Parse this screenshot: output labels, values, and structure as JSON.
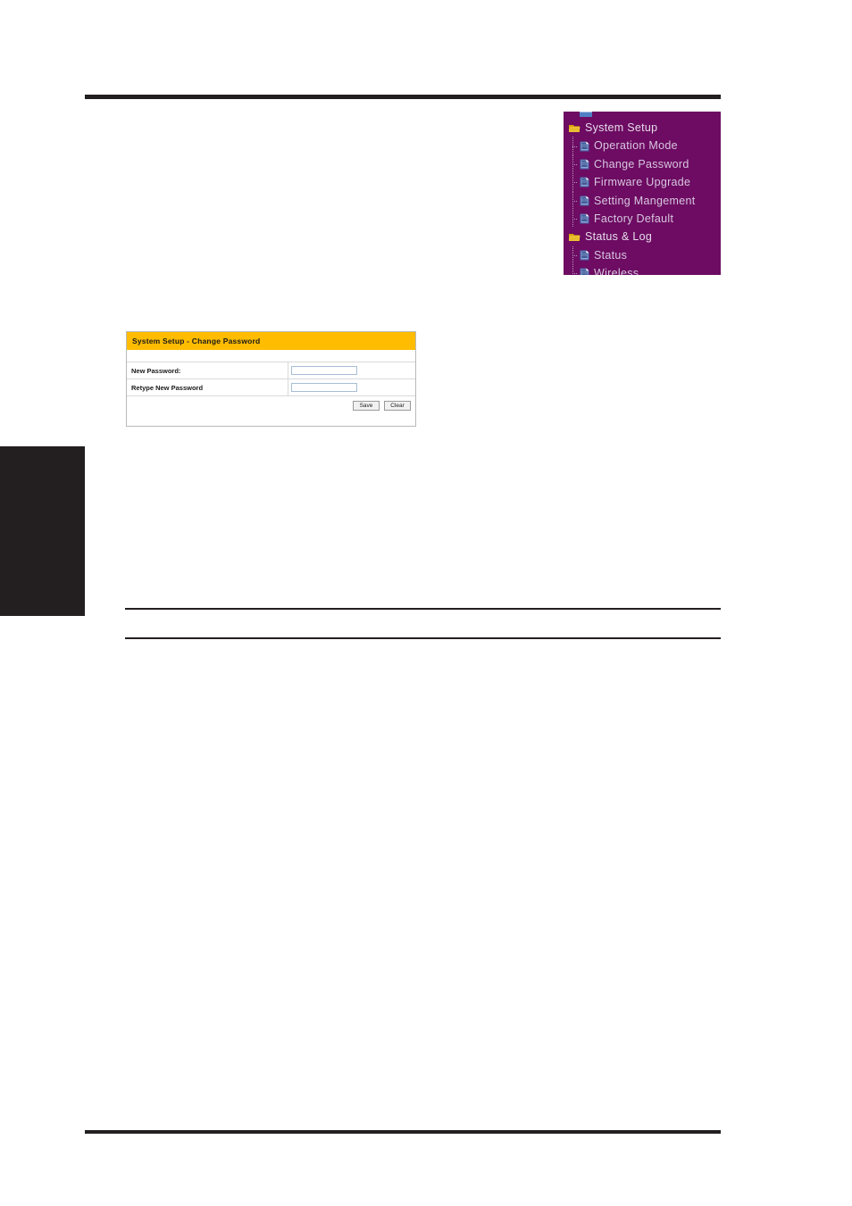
{
  "page": {
    "background_color": "#ffffff",
    "rule_color": "#231f20"
  },
  "side_tab": {
    "name": "chapter-side-tab",
    "color": "#231f20",
    "label": ""
  },
  "nav_menu": {
    "background_color": "#6d0c62",
    "text_color": "#d8c6e0",
    "items": [
      {
        "label": "System Setup",
        "icon": "folder-icon",
        "level": "parent"
      },
      {
        "label": "Operation Mode",
        "icon": "document-icon",
        "level": "child"
      },
      {
        "label": "Change Password",
        "icon": "document-icon",
        "level": "child"
      },
      {
        "label": "Firmware Upgrade",
        "icon": "document-icon",
        "level": "child"
      },
      {
        "label": "Setting Mangement",
        "icon": "document-icon",
        "level": "child"
      },
      {
        "label": "Factory Default",
        "icon": "document-icon",
        "level": "child"
      },
      {
        "label": "Status & Log",
        "icon": "folder-icon",
        "level": "parent"
      },
      {
        "label": "Status",
        "icon": "document-icon",
        "level": "child"
      },
      {
        "label": "Wireless",
        "icon": "document-icon",
        "level": "child"
      }
    ]
  },
  "panel": {
    "header_color": "#ffbc00",
    "title": "System Setup - Change Password",
    "fields": [
      {
        "label": "New Password:",
        "value": "",
        "placeholder": ""
      },
      {
        "label": "Retype New Password",
        "value": "",
        "placeholder": ""
      }
    ],
    "buttons": {
      "save": "Save",
      "clear": "Clear"
    }
  }
}
